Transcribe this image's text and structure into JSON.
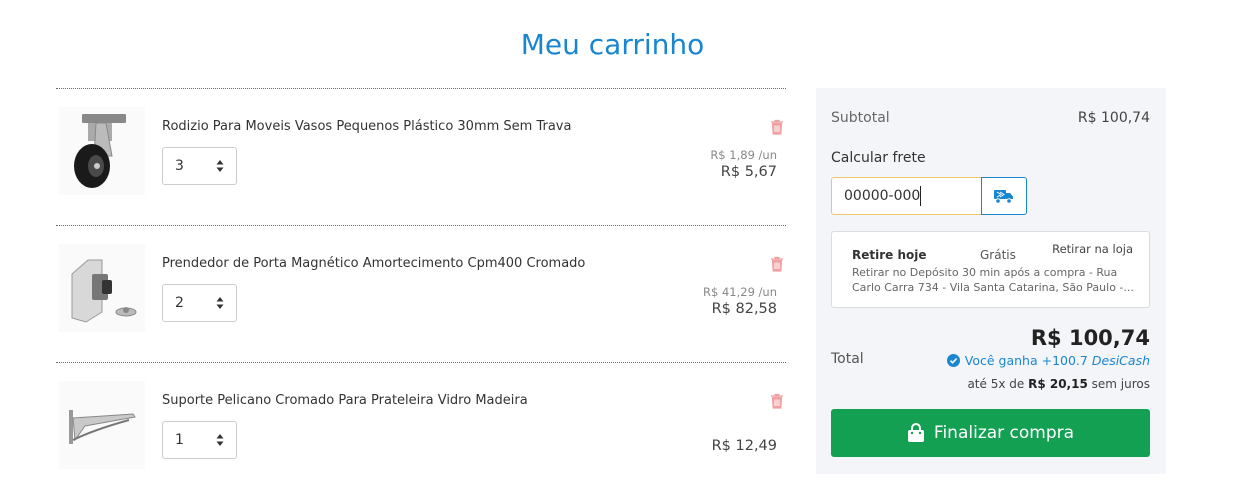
{
  "page": {
    "title": "Meu carrinho"
  },
  "cart": {
    "items": [
      {
        "name": "Rodizio Para Moveis Vasos Pequenos Plástico 30mm Sem Trava",
        "quantity": "3",
        "unit_price": "R$ 1,89 /un",
        "total_price": "R$ 5,67",
        "icon": "caster-wheel-image"
      },
      {
        "name": "Prendedor de Porta Magnético Amortecimento Cpm400 Cromado",
        "quantity": "2",
        "unit_price": "R$ 41,29 /un",
        "total_price": "R$ 82,58",
        "icon": "door-stopper-image"
      },
      {
        "name": "Suporte Pelicano Cromado Para Prateleira Vidro Madeira",
        "quantity": "1",
        "unit_price": "",
        "total_price": "R$ 12,49",
        "icon": "shelf-bracket-image"
      }
    ]
  },
  "summary": {
    "subtotal_label": "Subtotal",
    "subtotal_value": "R$ 100,74",
    "shipping_label": "Calcular frete",
    "cep_value": "00000-000",
    "shipping_option": {
      "title": "Retire hoje",
      "price": "Grátis",
      "tag": "Retirar na loja",
      "description": "Retirar no Depósito 30 min após a compra - Rua Carlo Carra 734 - Vila Santa Catarina, São Paulo -..."
    },
    "total_label": "Total",
    "total_value": "R$ 100,74",
    "cashback_text": "Você ganha +100.7",
    "cashback_brand": "DesiCash",
    "installments_prefix": "até 5x de",
    "installments_value": "R$ 20,15",
    "installments_suffix": "sem juros",
    "checkout_label": "Finalizar compra"
  },
  "colors": {
    "accent": "#1a86d0",
    "checkout": "#14a052",
    "trash": "#f0a0a0"
  }
}
